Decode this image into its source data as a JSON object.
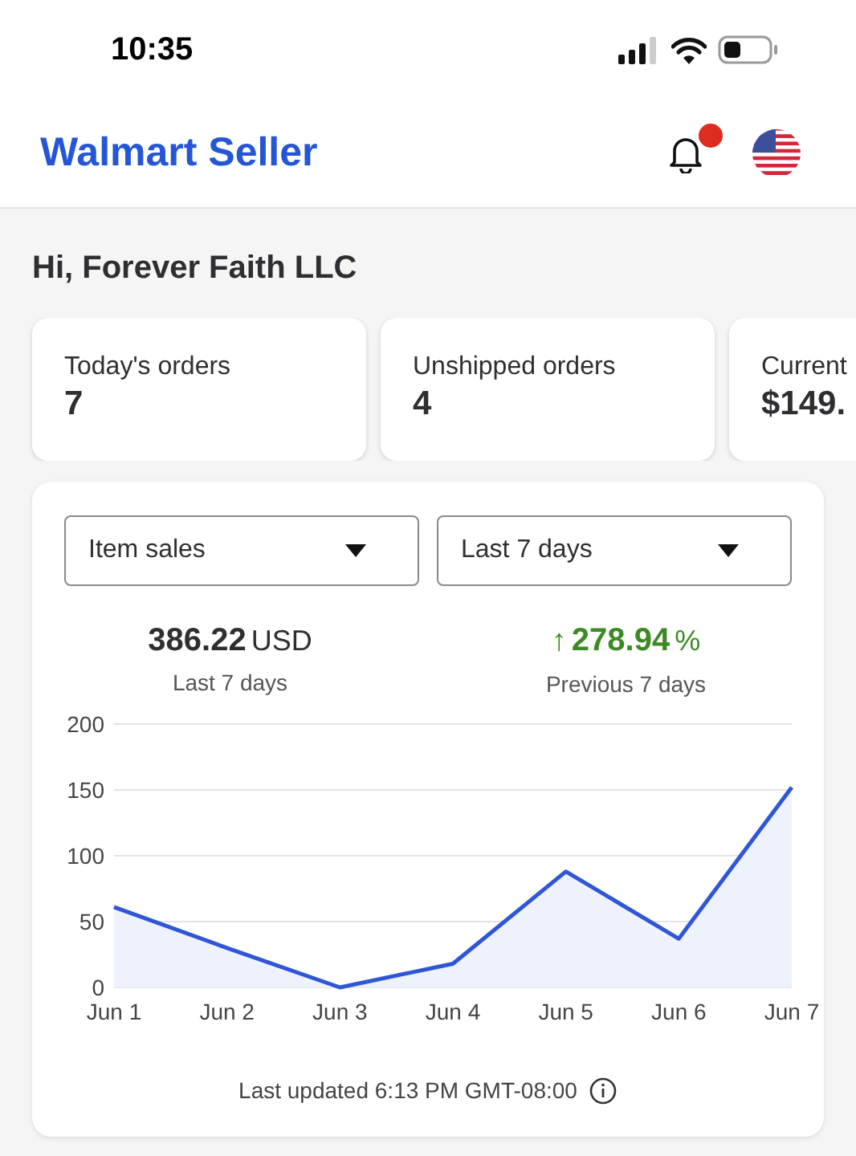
{
  "status_bar": {
    "time": "10:35"
  },
  "header": {
    "title": "Walmart Seller",
    "notification_badge": true
  },
  "greeting": "Hi, Forever Faith LLC",
  "stats": [
    {
      "label": "Today's orders",
      "value": "7"
    },
    {
      "label": "Unshipped orders",
      "value": "4"
    },
    {
      "label": "Current",
      "value": "$149."
    }
  ],
  "sales_card": {
    "metric_dropdown": "Item sales",
    "period_dropdown": "Last 7 days",
    "total": {
      "value": "386.22",
      "unit": "USD",
      "caption": "Last 7 days"
    },
    "change": {
      "arrow": "↑",
      "value": "278.94",
      "unit": "%",
      "caption": "Previous 7 days"
    },
    "chart_data": {
      "type": "area",
      "categories": [
        "Jun 1",
        "Jun 2",
        "Jun 3",
        "Jun 4",
        "Jun 5",
        "Jun 6",
        "Jun 7"
      ],
      "series": [
        {
          "color": "#2f56d6",
          "values": [
            61,
            30,
            0,
            18,
            88,
            37,
            152
          ]
        }
      ],
      "ylim": [
        0,
        200
      ],
      "yticks": [
        0,
        50,
        100,
        150,
        200
      ],
      "grid": true
    },
    "last_updated": "Last updated 6:13 PM GMT-08:00"
  }
}
